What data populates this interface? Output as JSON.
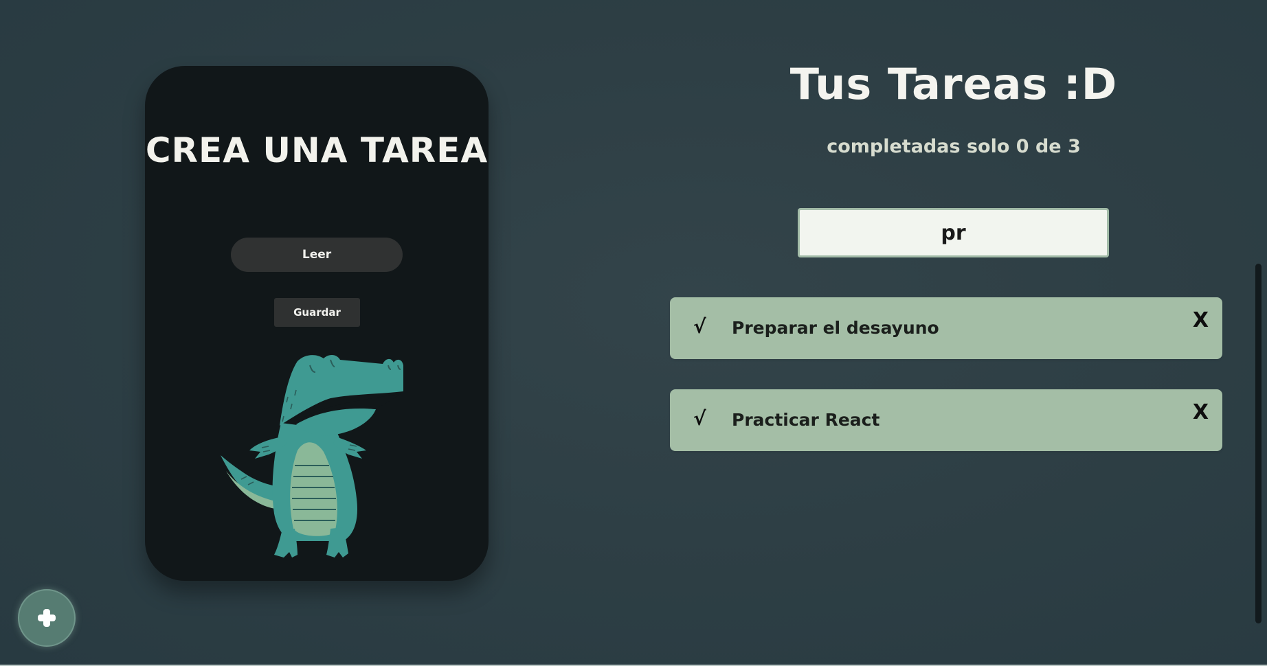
{
  "create_panel": {
    "title": "CREA UNA TAREA",
    "read_button": "Leer",
    "save_button": "Guardar",
    "illustration": "crocodile-illustration"
  },
  "tasks_panel": {
    "title": "Tus Tareas :D",
    "counter": "completadas solo 0 de 3",
    "search": {
      "value": "pr",
      "placeholder": ""
    },
    "items": [
      {
        "check_icon": "√",
        "text": "Preparar el desayuno",
        "delete_icon": "X",
        "completed": false
      },
      {
        "check_icon": "√",
        "text": "Practicar React",
        "delete_icon": "X",
        "completed": false
      }
    ]
  },
  "fab": {
    "icon": "plus-icon"
  },
  "colors": {
    "background": "#2e3f45",
    "card": "#111719",
    "task_item": "#a4bea6",
    "button": "#303232",
    "fab": "#567c72",
    "croc_body": "#3f9a92",
    "croc_belly": "#8ab898"
  }
}
